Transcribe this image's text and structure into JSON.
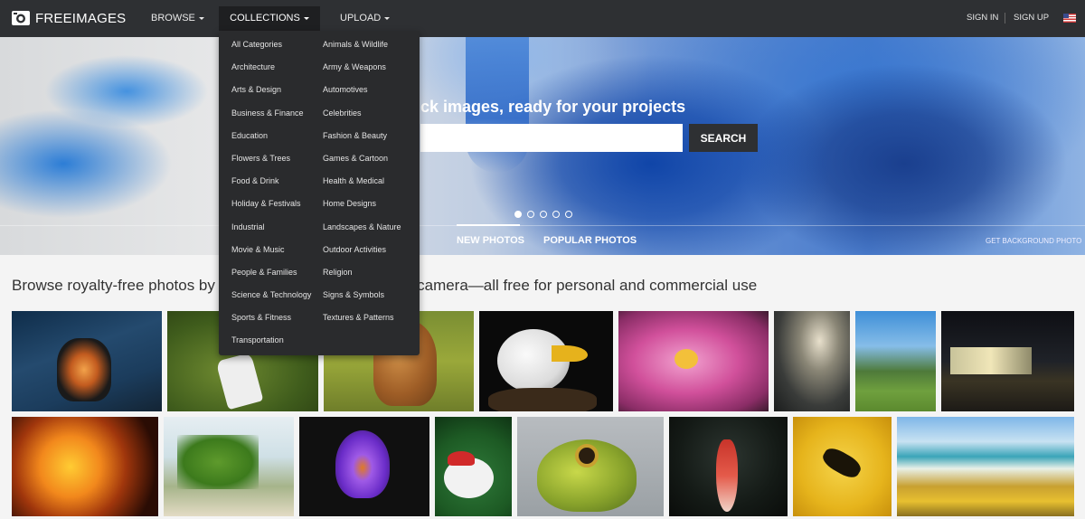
{
  "header": {
    "logo_text": "FREEIMAGES",
    "nav": {
      "browse": "BROWSE",
      "collections": "COLLECTIONS",
      "upload": "UPLOAD"
    },
    "sign_in": "SIGN IN",
    "sign_up": "SIGN UP",
    "flag_icon": "us-flag-icon"
  },
  "hero": {
    "heading": "ck images, ready for your projects",
    "search_value": "",
    "search_button": "SEARCH",
    "slides_total": 5,
    "slide_active": 1,
    "tab_new": "NEW PHOTOS",
    "tab_popular": "POPULAR PHOTOS",
    "get_background": "GET BACKGROUND PHOTO"
  },
  "tagline_left": "Browse royalty-free photos by s",
  "tagline_right": "camera—all free for personal and commercial use",
  "collections_menu": {
    "left": [
      "All Categories",
      "Architecture",
      "Arts & Design",
      "Business & Finance",
      "Education",
      "Flowers & Trees",
      "Food & Drink",
      "Holiday & Festivals",
      "Industrial",
      "Movie & Music",
      "People & Families",
      "Science & Technology",
      "Sports & Fitness",
      "Transportation"
    ],
    "right": [
      "Animals & Wildlife",
      "Army & Weapons",
      "Automotives",
      "Celebrities",
      "Fashion & Beauty",
      "Games & Cartoon",
      "Health & Medical",
      "Home Designs",
      "Landscapes & Nature",
      "Outdoor Activities",
      "Religion",
      "Signs & Symbols",
      "Textures & Patterns"
    ]
  },
  "photos": [
    {
      "name": "photo-butterfly-dress"
    },
    {
      "name": "photo-grass-figure"
    },
    {
      "name": "photo-horse"
    },
    {
      "name": "photo-bald-eagle"
    },
    {
      "name": "photo-pink-lotus"
    },
    {
      "name": "photo-stormy-sky"
    },
    {
      "name": "photo-mountain-valley"
    },
    {
      "name": "photo-night-station"
    },
    {
      "name": "photo-jack-o-lantern"
    },
    {
      "name": "photo-green-leaves"
    },
    {
      "name": "photo-purple-crocus"
    },
    {
      "name": "photo-santa-rabbit"
    },
    {
      "name": "photo-frog"
    },
    {
      "name": "photo-black-swan"
    },
    {
      "name": "photo-wasp"
    },
    {
      "name": "photo-beach-flowers"
    }
  ]
}
